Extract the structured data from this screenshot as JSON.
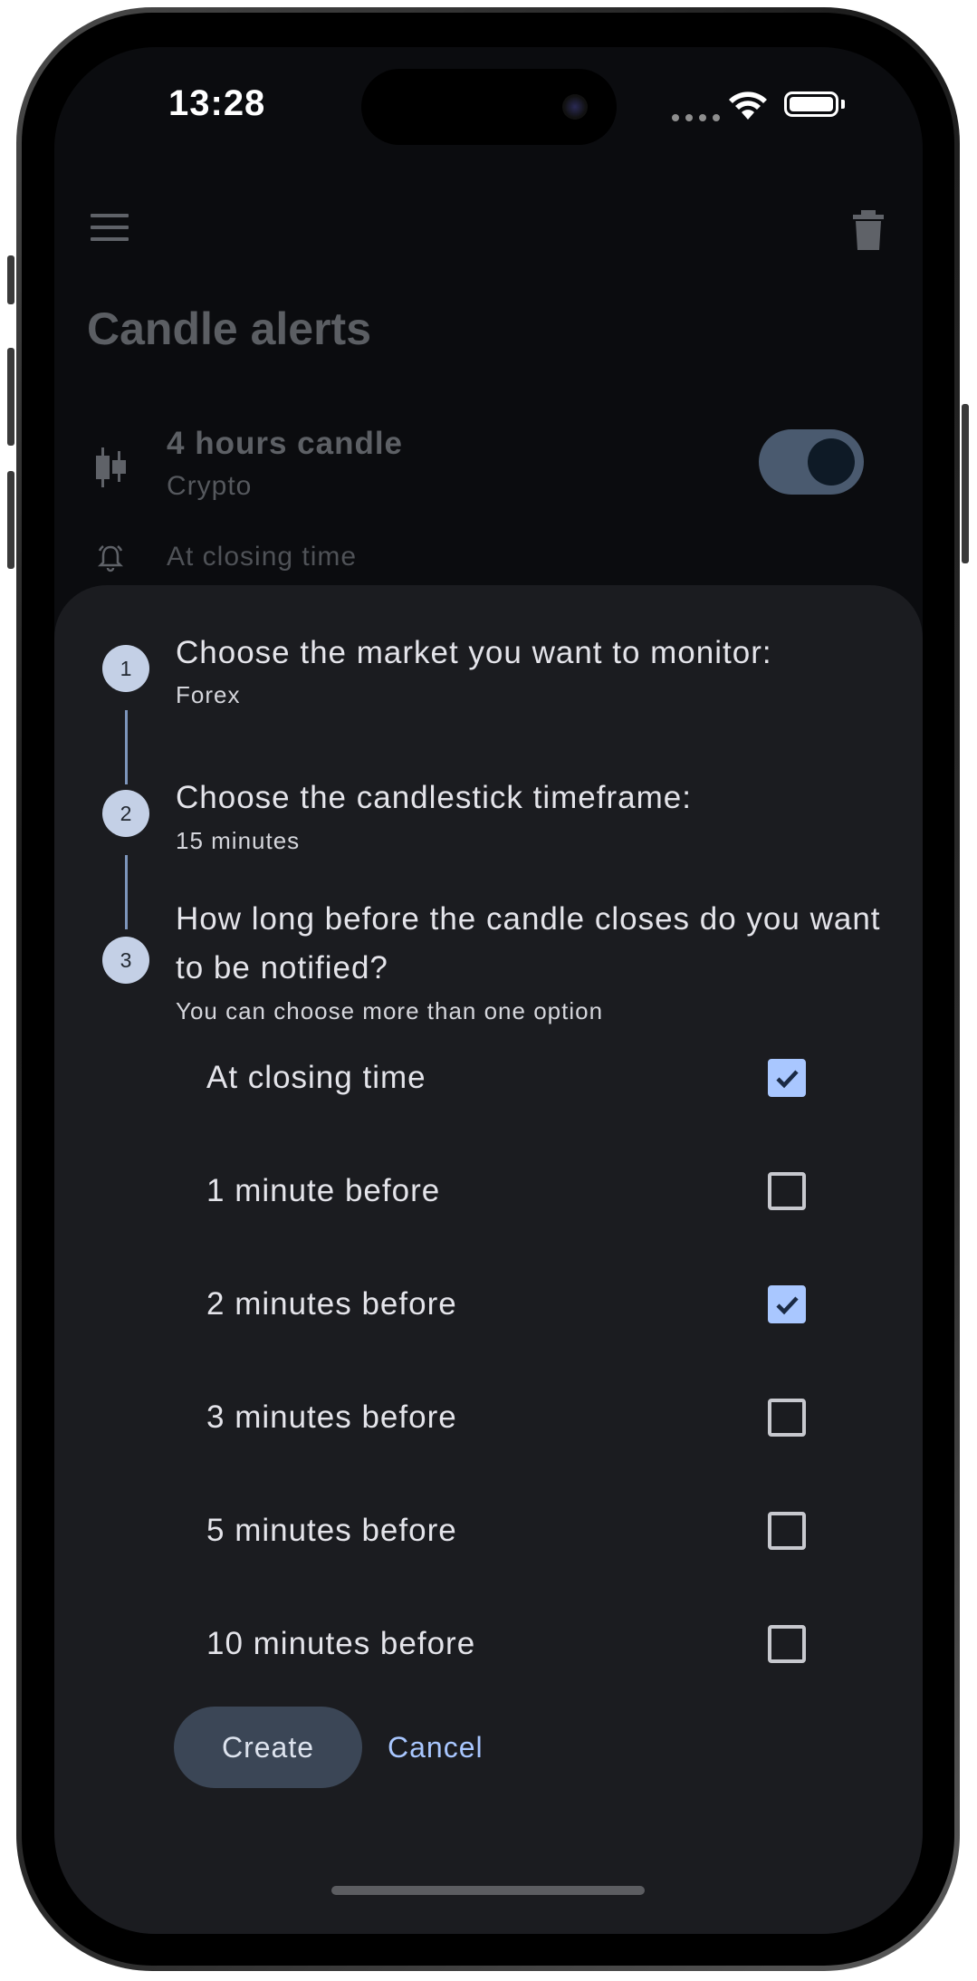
{
  "status_bar": {
    "time": "13:28",
    "icons": [
      "signal-dots-icon",
      "wifi-icon",
      "battery-icon"
    ]
  },
  "app_bar": {
    "menu_icon": "hamburger-menu-icon",
    "delete_icon": "trash-icon",
    "title": "Candle alerts"
  },
  "existing_alert": {
    "icon": "candlestick-icon",
    "title": "4 hours candle",
    "subtitle": "Crypto",
    "enabled": true,
    "bell_icon": "bell-icon",
    "timing": "At closing time"
  },
  "sheet": {
    "steps": [
      {
        "number": "1",
        "title": "Choose the market you want to monitor:",
        "value": "Forex"
      },
      {
        "number": "2",
        "title": "Choose the candlestick timeframe:",
        "value": "15 minutes"
      },
      {
        "number": "3",
        "title": "How long before the candle closes do you want to be notified?",
        "value": "You can choose more than one option"
      }
    ],
    "options": [
      {
        "label": "At closing time",
        "checked": true
      },
      {
        "label": "1 minute before",
        "checked": false
      },
      {
        "label": "2 minutes before",
        "checked": true
      },
      {
        "label": "3 minutes before",
        "checked": false
      },
      {
        "label": "5 minutes before",
        "checked": false
      },
      {
        "label": "10 minutes before",
        "checked": false
      }
    ],
    "create_label": "Create",
    "cancel_label": "Cancel"
  },
  "colors": {
    "accent": "#a9c7ff",
    "sheet_background": "#1b1c20",
    "screen_background": "#0b0c0f"
  }
}
